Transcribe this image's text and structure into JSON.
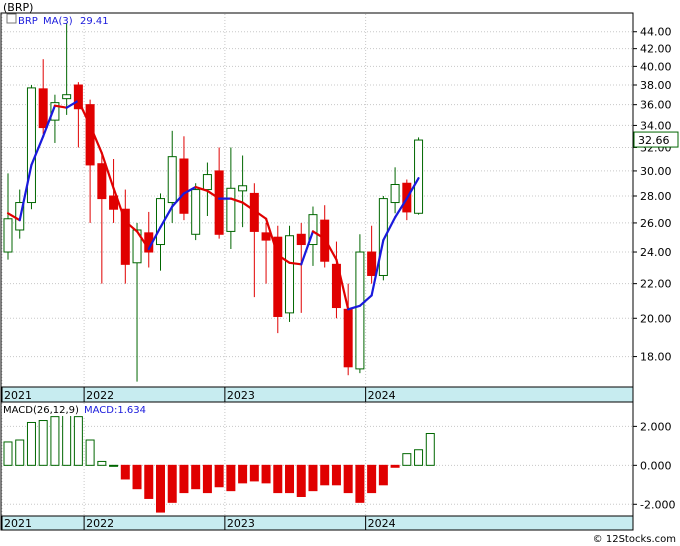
{
  "title": "(BRP)",
  "watermark": "© 12Stocks.com",
  "colors": {
    "up": "#006600",
    "down": "#e00000",
    "ma_up": "#1a1adc",
    "ma_down": "#e00000",
    "band": "#c7ecf0",
    "grid": "#c8c8c8",
    "macd_label": "#1a1adc"
  },
  "chart_data": [
    {
      "type": "candlestick",
      "ticker_label": "BRP",
      "ma_label": "MA(3)",
      "ma_value": "29.41",
      "last_price_label": "32.66",
      "x_labels": [
        "2021",
        "2022",
        "2023",
        "2024"
      ],
      "x_label_index": [
        0,
        7,
        19,
        31
      ],
      "y_ticks": [
        18.0,
        20.0,
        22.0,
        24.0,
        26.0,
        28.0,
        30.0,
        32.0,
        34.0,
        36.0,
        38.0,
        40.0,
        42.0,
        44.0
      ],
      "y_tick_labels": [
        "18.00",
        "20.00",
        "22.00",
        "24.00",
        "26.00",
        "28.00",
        "30.00",
        "32.00",
        "34.00",
        "36.00",
        "38.00",
        "40.00",
        "42.00",
        "44.00"
      ],
      "ylim": [
        16.6,
        46.2
      ],
      "y_scale": "log",
      "candles": [
        {
          "o": 24.0,
          "h": 29.8,
          "l": 23.5,
          "c": 26.3
        },
        {
          "o": 25.5,
          "h": 28.5,
          "l": 24.9,
          "c": 27.5
        },
        {
          "o": 27.5,
          "h": 38.0,
          "l": 27.0,
          "c": 37.7
        },
        {
          "o": 37.6,
          "h": 40.8,
          "l": 33.2,
          "c": 33.8
        },
        {
          "o": 34.5,
          "h": 37.0,
          "l": 32.4,
          "c": 36.2
        },
        {
          "o": 36.6,
          "h": 45.0,
          "l": 35.0,
          "c": 37.0
        },
        {
          "o": 38.0,
          "h": 38.3,
          "l": 32.0,
          "c": 35.6
        },
        {
          "o": 36.0,
          "h": 36.5,
          "l": 26.0,
          "c": 30.5
        },
        {
          "o": 30.6,
          "h": 31.5,
          "l": 22.0,
          "c": 27.8
        },
        {
          "o": 28.0,
          "h": 31.0,
          "l": 26.0,
          "c": 27.0
        },
        {
          "o": 27.0,
          "h": 28.5,
          "l": 22.0,
          "c": 23.2
        },
        {
          "o": 23.3,
          "h": 26.0,
          "l": 16.8,
          "c": 25.5
        },
        {
          "o": 25.3,
          "h": 26.8,
          "l": 23.0,
          "c": 24.0
        },
        {
          "o": 24.5,
          "h": 28.2,
          "l": 22.8,
          "c": 27.8
        },
        {
          "o": 27.5,
          "h": 33.5,
          "l": 26.0,
          "c": 31.2
        },
        {
          "o": 31.0,
          "h": 33.0,
          "l": 26.2,
          "c": 26.7
        },
        {
          "o": 25.2,
          "h": 29.0,
          "l": 24.8,
          "c": 28.5
        },
        {
          "o": 28.5,
          "h": 30.7,
          "l": 26.5,
          "c": 29.7
        },
        {
          "o": 30.0,
          "h": 32.0,
          "l": 24.9,
          "c": 25.2
        },
        {
          "o": 25.4,
          "h": 32.0,
          "l": 24.2,
          "c": 28.6
        },
        {
          "o": 28.4,
          "h": 31.3,
          "l": 25.7,
          "c": 28.8
        },
        {
          "o": 28.2,
          "h": 29.0,
          "l": 21.2,
          "c": 25.4
        },
        {
          "o": 25.3,
          "h": 26.0,
          "l": 22.0,
          "c": 24.8
        },
        {
          "o": 25.0,
          "h": 25.8,
          "l": 19.2,
          "c": 20.1
        },
        {
          "o": 20.3,
          "h": 25.8,
          "l": 19.8,
          "c": 25.1
        },
        {
          "o": 25.2,
          "h": 26.0,
          "l": 20.3,
          "c": 24.5
        },
        {
          "o": 24.5,
          "h": 27.2,
          "l": 23.1,
          "c": 26.6
        },
        {
          "o": 26.2,
          "h": 27.3,
          "l": 23.0,
          "c": 23.4
        },
        {
          "o": 23.2,
          "h": 24.7,
          "l": 20.0,
          "c": 20.6
        },
        {
          "o": 20.5,
          "h": 22.0,
          "l": 17.1,
          "c": 17.5
        },
        {
          "o": 17.4,
          "h": 25.2,
          "l": 17.2,
          "c": 24.0
        },
        {
          "o": 24.0,
          "h": 25.8,
          "l": 22.0,
          "c": 22.5
        },
        {
          "o": 22.5,
          "h": 28.0,
          "l": 22.2,
          "c": 27.8
        },
        {
          "o": 27.5,
          "h": 30.3,
          "l": 26.7,
          "c": 28.9
        },
        {
          "o": 29.0,
          "h": 29.3,
          "l": 26.2,
          "c": 26.8
        },
        {
          "o": 26.7,
          "h": 32.9,
          "l": 26.6,
          "c": 32.66
        }
      ],
      "ma": [
        26.7,
        26.2,
        30.5,
        33.0,
        35.9,
        35.7,
        36.4,
        34.0,
        31.5,
        28.6,
        26.1,
        25.4,
        24.2,
        25.7,
        27.2,
        28.2,
        28.7,
        28.4,
        27.8,
        27.8,
        27.5,
        26.9,
        26.3,
        23.8,
        23.3,
        23.2,
        25.4,
        24.9,
        23.5,
        20.5,
        20.7,
        21.3,
        24.8,
        26.4,
        27.8,
        29.41
      ]
    },
    {
      "type": "bar",
      "indicator_label": "MACD(26,12,9)",
      "value_label": "MACD:1.634",
      "x_labels": [
        "2021",
        "2022",
        "2023",
        "2024"
      ],
      "x_label_index": [
        0,
        7,
        19,
        31
      ],
      "y_ticks": [
        -2.0,
        0.0,
        2.0
      ],
      "y_tick_labels": [
        "-2.000",
        "0.000",
        "2.000"
      ],
      "ylim": [
        -2.55,
        3.2
      ],
      "values": [
        1.2,
        1.3,
        2.2,
        2.3,
        2.5,
        2.6,
        2.5,
        1.3,
        0.2,
        0.0,
        -0.7,
        -1.2,
        -1.7,
        -2.4,
        -1.9,
        -1.4,
        -1.2,
        -1.4,
        -1.1,
        -1.3,
        -0.9,
        -0.8,
        -0.9,
        -1.4,
        -1.4,
        -1.6,
        -1.3,
        -1.0,
        -1.0,
        -1.4,
        -1.9,
        -1.4,
        -1.0,
        -0.1,
        0.6,
        0.8,
        1.634
      ]
    }
  ]
}
